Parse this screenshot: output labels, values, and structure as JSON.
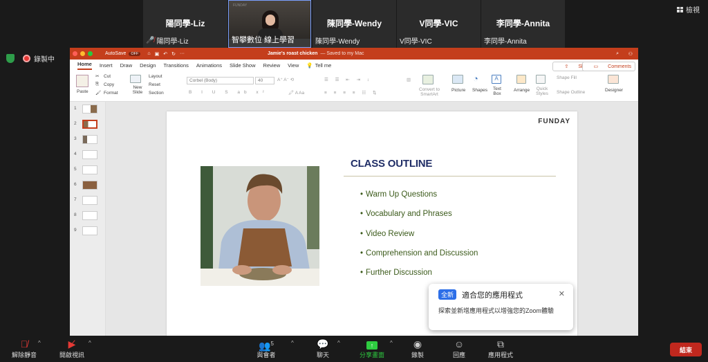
{
  "participants": [
    {
      "name_large": "陽同學-Liz",
      "name_small": "陽同學-Liz",
      "muted": true
    },
    {
      "name_large": "",
      "name_small": "智攀數位 線上學習",
      "muted": false,
      "video": true,
      "watermark": "FUNDAY"
    },
    {
      "name_large": "陳同學-Wendy",
      "name_small": "陳同學-Wendy",
      "muted": false
    },
    {
      "name_large": "V同學-VIC",
      "name_small": "V同學-VIC",
      "muted": false
    },
    {
      "name_large": "李同學-Annita",
      "name_small": "李同學-Annita",
      "muted": false
    }
  ],
  "view_button": "檢視",
  "recording_label": "錄製中",
  "ppt": {
    "autosave_label": "AutoSave",
    "autosave_state": "OFF",
    "window_title": "Jamie's roast chicken",
    "save_status": "— Saved to my Mac",
    "tabs": [
      "Home",
      "Insert",
      "Draw",
      "Design",
      "Transitions",
      "Animations",
      "Slide Show",
      "Review",
      "View"
    ],
    "tell_me": "Tell me",
    "share_label": "Share",
    "comments_label": "Comments",
    "paste_label": "Paste",
    "cut_label": "Cut",
    "copy_label": "Copy",
    "format_label": "Format",
    "new_slide_label": "New Slide",
    "layout_label": "Layout",
    "reset_label": "Reset",
    "section_label": "Section",
    "font_name": "Corbel (Body)",
    "font_size": "40",
    "convert_label": "Convert to SmartArt",
    "picture_label": "Picture",
    "shapes_label": "Shapes",
    "textbox_label": "Text Box",
    "arrange_label": "Arrange",
    "quick_styles_label": "Quick Styles",
    "shape_fill_label": "Shape Fill",
    "shape_outline_label": "Shape Outline",
    "designer_label": "Designer",
    "slide_numbers": [
      "1",
      "2",
      "3",
      "4",
      "5",
      "6",
      "7",
      "8",
      "9"
    ],
    "slide": {
      "logo": "FUNDAY",
      "title": "CLASS OUTLINE",
      "bullets": [
        "Warm Up Questions",
        "Vocabulary and Phrases",
        "Video Review",
        "Comprehension and Discussion",
        "Further Discussion"
      ]
    }
  },
  "popup": {
    "badge": "全新",
    "title": "適合您的應用程式",
    "body": "探索並新增應用程式以增強您的Zoom體驗"
  },
  "toolbar": {
    "mute": "解除靜音",
    "video": "開啟視訊",
    "participants": "與會者",
    "participants_count": "5",
    "chat": "聊天",
    "share": "分享畫面",
    "record": "錄製",
    "reactions": "回應",
    "apps": "應用程式",
    "end": "結束"
  },
  "colors": {
    "ppt_accent": "#c43e1c",
    "share_green": "#2ecc40",
    "end_red": "#c0281e",
    "slide_title": "#1f2d66",
    "bullet_green": "#3b5a1a"
  }
}
